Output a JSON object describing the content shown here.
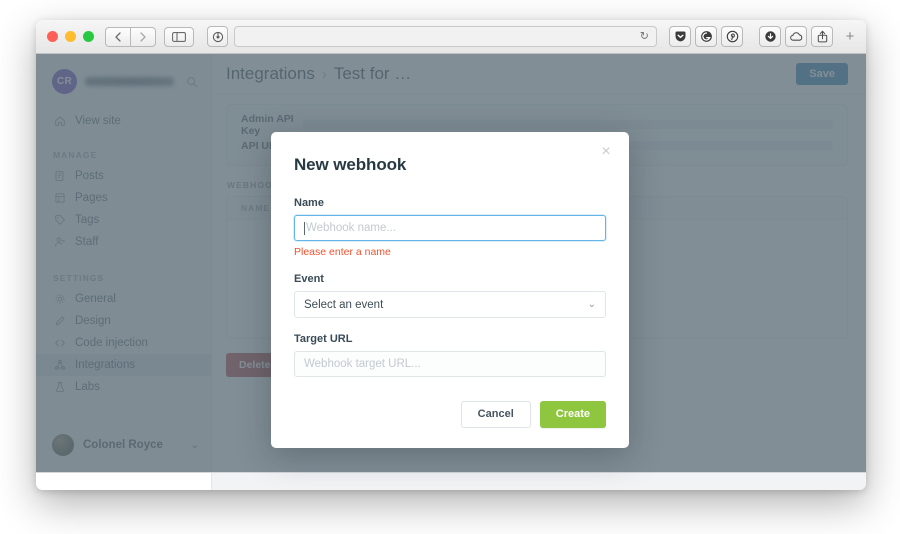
{
  "browser": {
    "window_controls": [
      "close",
      "minimize",
      "maximize"
    ],
    "nav": {
      "back_label": "‹",
      "forward_label": "›"
    },
    "sidebar_toggle_label": "sidebar",
    "url_value": "",
    "url_placeholder": "",
    "reload_label": "↻",
    "extensions": [
      "pocket-icon",
      "grammarly-icon",
      "pinterest-icon"
    ],
    "right_tools": [
      "downloads-icon",
      "icloud-icon",
      "share-icon"
    ],
    "new_tab_label": "+"
  },
  "sidebar": {
    "avatar_initials": "CR",
    "site_name": "",
    "search_icon": "search-icon",
    "view_site": {
      "label": "View site",
      "icon": "home-icon"
    },
    "sections": [
      {
        "title": "MANAGE",
        "items": [
          {
            "label": "Posts",
            "icon": "posts-icon",
            "active": false
          },
          {
            "label": "Pages",
            "icon": "pages-icon",
            "active": false
          },
          {
            "label": "Tags",
            "icon": "tag-icon",
            "active": false
          },
          {
            "label": "Staff",
            "icon": "staff-icon",
            "active": false
          }
        ]
      },
      {
        "title": "SETTINGS",
        "items": [
          {
            "label": "General",
            "icon": "gear-icon",
            "active": false
          },
          {
            "label": "Design",
            "icon": "pen-icon",
            "active": false
          },
          {
            "label": "Code injection",
            "icon": "code-icon",
            "active": false
          },
          {
            "label": "Integrations",
            "icon": "integrations-icon",
            "active": true
          },
          {
            "label": "Labs",
            "icon": "flask-icon",
            "active": false
          }
        ]
      }
    ],
    "user": {
      "name": "Colonel Royce",
      "caret": "⌄"
    }
  },
  "main": {
    "breadcrumb": {
      "root": "Integrations",
      "separator": "›",
      "current": "Test for …"
    },
    "save_label": "Save",
    "panel": {
      "admin_key_label": "Admin API Key",
      "api_url_label": "API URL"
    },
    "webhooks_section_title": "WEBHOOKS",
    "webhooks_columns": [
      "NAME"
    ],
    "webhooks_rows": [],
    "delete_label": "Delete Integration"
  },
  "modal": {
    "title": "New webhook",
    "close_label": "×",
    "fields": {
      "name": {
        "label": "Name",
        "value": "",
        "placeholder": "Webhook name...",
        "error": "Please enter a name",
        "focused": true
      },
      "event": {
        "label": "Event",
        "selected": "Select an event",
        "caret": "⌄"
      },
      "target_url": {
        "label": "Target URL",
        "value": "",
        "placeholder": "Webhook target URL..."
      }
    },
    "cancel_label": "Cancel",
    "create_label": "Create"
  },
  "colors": {
    "accent_blue": "#2f7bb0",
    "create_green": "#8ec63f",
    "danger_red": "#b33b3b",
    "error_text": "#f05230",
    "focus_border": "#62b5e6",
    "avatar_purple": "#6b46c1",
    "overlay": "#5e6e79"
  }
}
